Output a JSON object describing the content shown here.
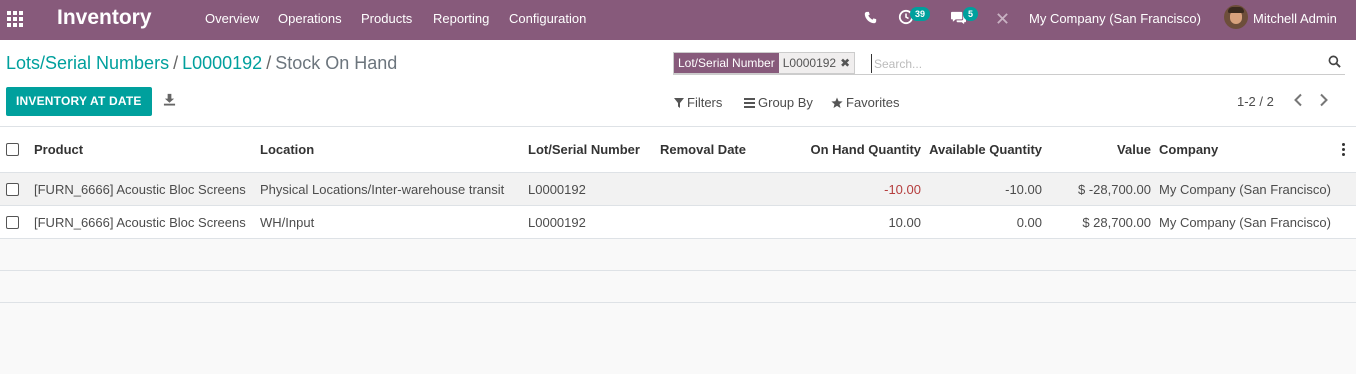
{
  "navbar": {
    "app_name": "Inventory",
    "menu": [
      "Overview",
      "Operations",
      "Products",
      "Reporting",
      "Configuration"
    ],
    "activity_count": "39",
    "message_count": "5",
    "company": "My Company (San Francisco)",
    "user": "Mitchell Admin"
  },
  "breadcrumb": {
    "items": [
      "Lots/Serial Numbers",
      "L0000192"
    ],
    "current": "Stock On Hand",
    "separator": "/"
  },
  "search": {
    "facet_label": "Lot/Serial Number",
    "facet_value": "L0000192",
    "placeholder": "Search..."
  },
  "toolbar": {
    "primary_button": "INVENTORY AT DATE",
    "filters": "Filters",
    "group_by": "Group By",
    "favorites": "Favorites"
  },
  "pager": {
    "value": "1-2 / 2"
  },
  "table": {
    "columns": [
      "Product",
      "Location",
      "Lot/Serial Number",
      "Removal Date",
      "On Hand Quantity",
      "Available Quantity",
      "Value",
      "Company"
    ],
    "rows": [
      {
        "product": "[FURN_6666] Acoustic Bloc Screens",
        "location": "Physical Locations/Inter-warehouse transit",
        "lot": "L0000192",
        "removal_date": "",
        "on_hand": "-10.00",
        "available": "-10.00",
        "value": "$ -28,700.00",
        "company": "My Company (San Francisco)"
      },
      {
        "product": "[FURN_6666] Acoustic Bloc Screens",
        "location": "WH/Input",
        "lot": "L0000192",
        "removal_date": "",
        "on_hand": "10.00",
        "available": "0.00",
        "value": "$ 28,700.00",
        "company": "My Company (San Francisco)"
      }
    ]
  },
  "colors": {
    "brand": "#875a7b",
    "accent": "#00a09d",
    "negative": "#b53e3e"
  }
}
